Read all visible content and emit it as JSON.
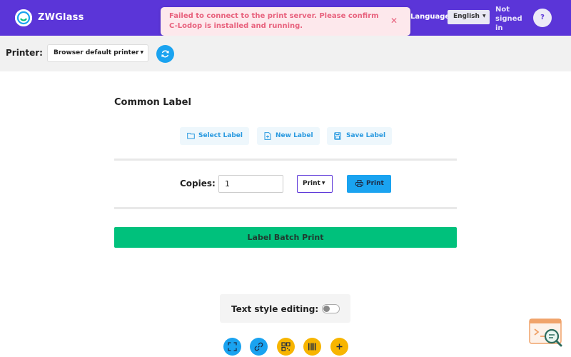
{
  "header": {
    "brand": "ZWGlass",
    "language_label": "Language",
    "language_value": "English",
    "signin_status": "Not signed in",
    "help_label": "?"
  },
  "toast": {
    "message": "Failed to connect to the print server. Please confirm C-Lodop is installed and running.",
    "close_symbol": "✕"
  },
  "printer_bar": {
    "label": "Printer:",
    "selected_printer": "Browser default printer"
  },
  "card": {
    "title": "Common Label",
    "actions": {
      "select": "Select Label",
      "new": "New Label",
      "save": "Save Label"
    },
    "copies_label": "Copies:",
    "copies_value": "1",
    "print_mode": "Print",
    "print_button": "Print",
    "batch_button": "Label Batch Print"
  },
  "style_editing": {
    "label": "Text style editing:",
    "enabled": false
  },
  "tools": [
    "fullscreen-icon",
    "link-icon",
    "qrcode-icon",
    "barcode-icon",
    "plus-icon"
  ],
  "colors": {
    "header": "#5b35d8",
    "accent": "#1aa3f0",
    "batch": "#00c17c",
    "tool_yellow": "#f7b500",
    "toast_text": "#e8617d"
  }
}
